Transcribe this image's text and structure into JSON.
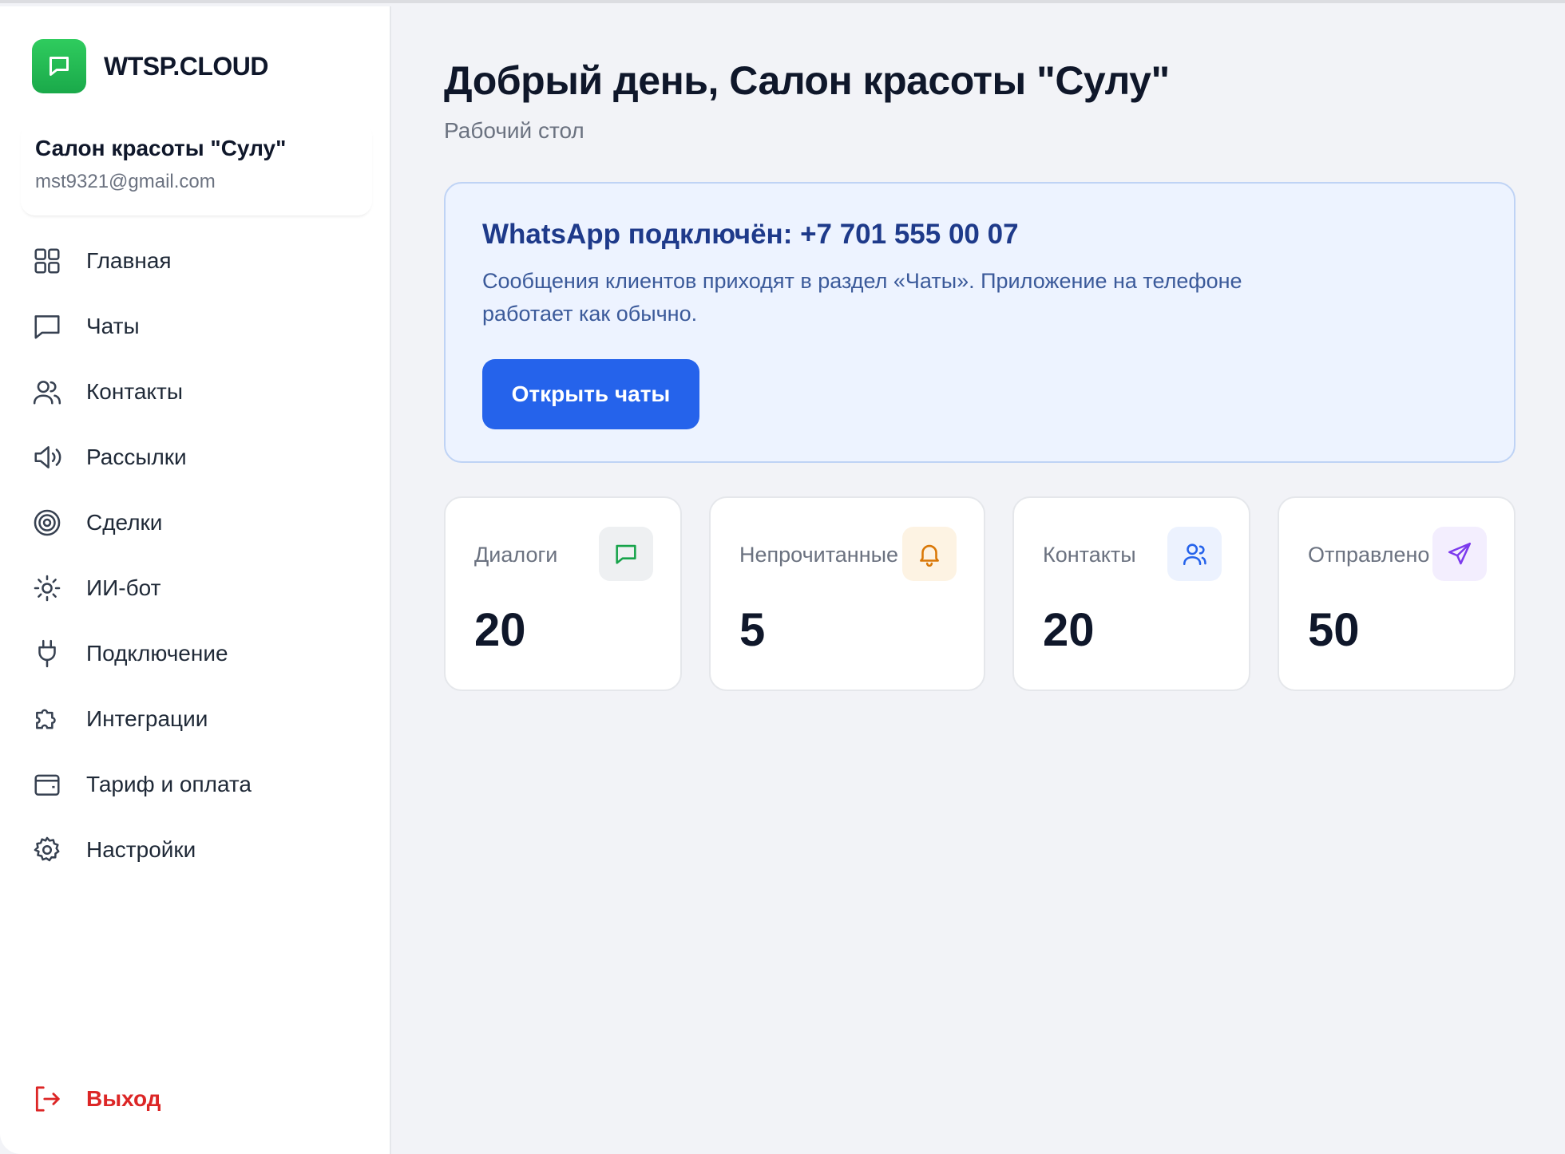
{
  "brand": {
    "name": "WTSP.CLOUD"
  },
  "account": {
    "org_name": "Салон красоты \"Сулу\"",
    "email": "mst9321@gmail.com"
  },
  "sidebar": {
    "items": [
      {
        "label": "Главная",
        "icon": "grid-icon"
      },
      {
        "label": "Чаты",
        "icon": "chat-icon"
      },
      {
        "label": "Контакты",
        "icon": "users-icon"
      },
      {
        "label": "Рассылки",
        "icon": "megaphone-icon"
      },
      {
        "label": "Сделки",
        "icon": "target-icon"
      },
      {
        "label": "ИИ-бот",
        "icon": "sun-icon"
      },
      {
        "label": "Подключение",
        "icon": "plug-icon"
      },
      {
        "label": "Интеграции",
        "icon": "puzzle-icon"
      },
      {
        "label": "Тариф и оплата",
        "icon": "wallet-icon"
      },
      {
        "label": "Настройки",
        "icon": "gear-icon"
      }
    ],
    "logout_label": "Выход"
  },
  "main": {
    "title": "Добрый день, Салон красоты \"Сулу\"",
    "subtitle": "Рабочий стол",
    "banner": {
      "title": "WhatsApp подключён: +7 701 555 00 07",
      "text": "Сообщения клиентов приходят в раздел «Чаты». Приложение на телефоне работает как обычно.",
      "button_label": "Открыть чаты"
    },
    "stats": [
      {
        "label": "Диалоги",
        "value": "20",
        "icon": "chat-icon",
        "color": "#16a34a"
      },
      {
        "label": "Непрочитанные",
        "value": "5",
        "icon": "bell-icon",
        "color": "#d97706"
      },
      {
        "label": "Контакты",
        "value": "20",
        "icon": "user-icon",
        "color": "#2563eb"
      },
      {
        "label": "Отправлено",
        "value": "50",
        "icon": "send-icon",
        "color": "#7c3aed"
      }
    ]
  },
  "colors": {
    "accent": "#2563eb",
    "brand_green": "#1fb653",
    "danger": "#dc2626"
  }
}
